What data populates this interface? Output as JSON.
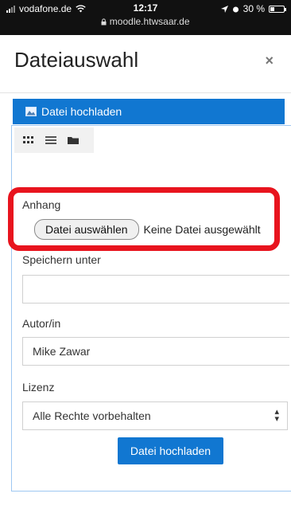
{
  "status_bar": {
    "carrier": "vodafone.de",
    "time": "12:17",
    "url": "moodle.htwsaar.de",
    "battery": "30 %",
    "battery_level": 0.3
  },
  "modal": {
    "title": "Dateiauswahl",
    "close": "×"
  },
  "repository_tab": {
    "label": "Datei hochladen"
  },
  "form": {
    "attachment_label": "Anhang",
    "choose_button": "Datei auswählen",
    "choose_status": "Keine Datei ausgewählt",
    "save_as_label": "Speichern unter",
    "save_as_value": "",
    "author_label": "Autor/in",
    "author_value": "Mike Zawar",
    "license_label": "Lizenz",
    "license_value": "Alle Rechte vorbehalten",
    "submit": "Datei hochladen"
  },
  "icons": [
    "signal-icon",
    "wifi-icon",
    "lock-icon",
    "location-icon",
    "alarm-icon",
    "battery-icon",
    "upload-icon",
    "grid-view-icon",
    "list-view-icon",
    "folder-view-icon"
  ]
}
